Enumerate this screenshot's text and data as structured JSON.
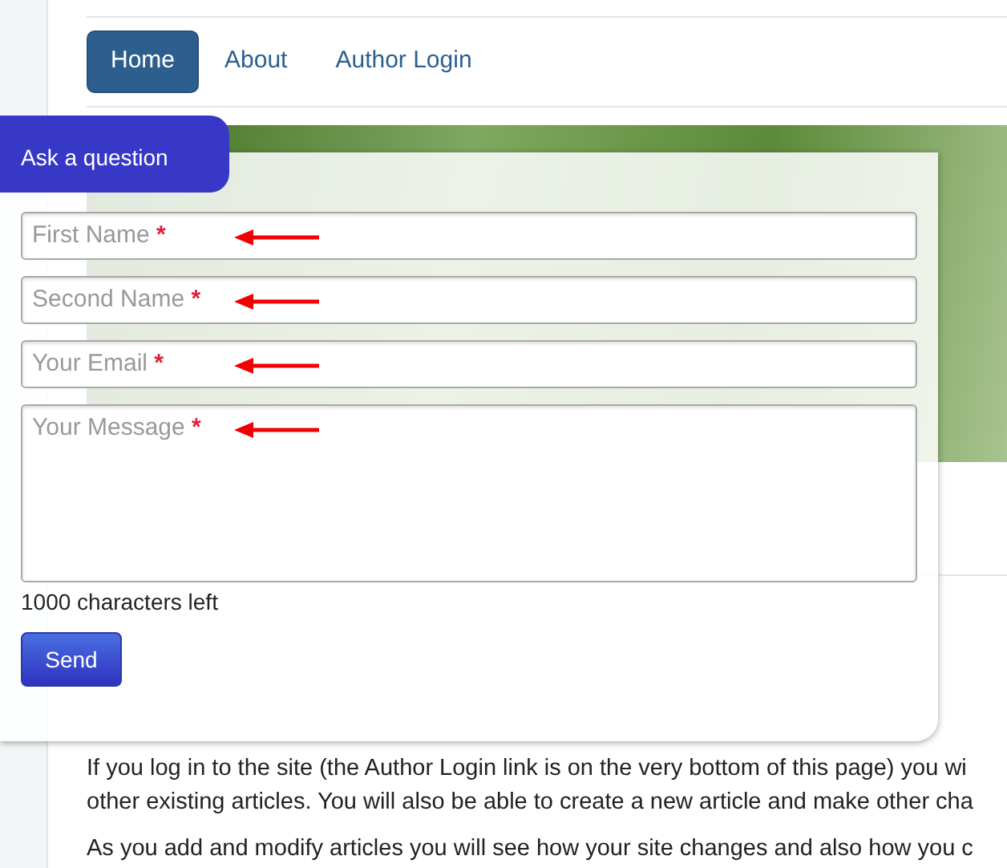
{
  "nav": [
    {
      "label": "Home",
      "selected": true
    },
    {
      "label": "About",
      "selected": false
    },
    {
      "label": "Author Login",
      "selected": false
    }
  ],
  "article": {
    "paragraphs": [
      [
        "If you log in to the site (the Author Login link is on the very bottom of this page) you wi",
        "other existing articles. You will also be able to create a new article and make other cha"
      ],
      [
        "As you add and modify articles you will see how your site changes and also how you c"
      ]
    ]
  },
  "question_form": {
    "tab": "Ask a question",
    "fields": [
      {
        "kind": "input",
        "placeholder": "First Name",
        "required_mark": "*"
      },
      {
        "kind": "input",
        "placeholder": "Second Name",
        "required_mark": "*"
      },
      {
        "kind": "input",
        "placeholder": "Your Email",
        "required_mark": "*"
      },
      {
        "kind": "textarea",
        "placeholder": "Your Message",
        "required_mark": "*"
      }
    ],
    "counter": "1000 characters left",
    "submit": "Send"
  }
}
